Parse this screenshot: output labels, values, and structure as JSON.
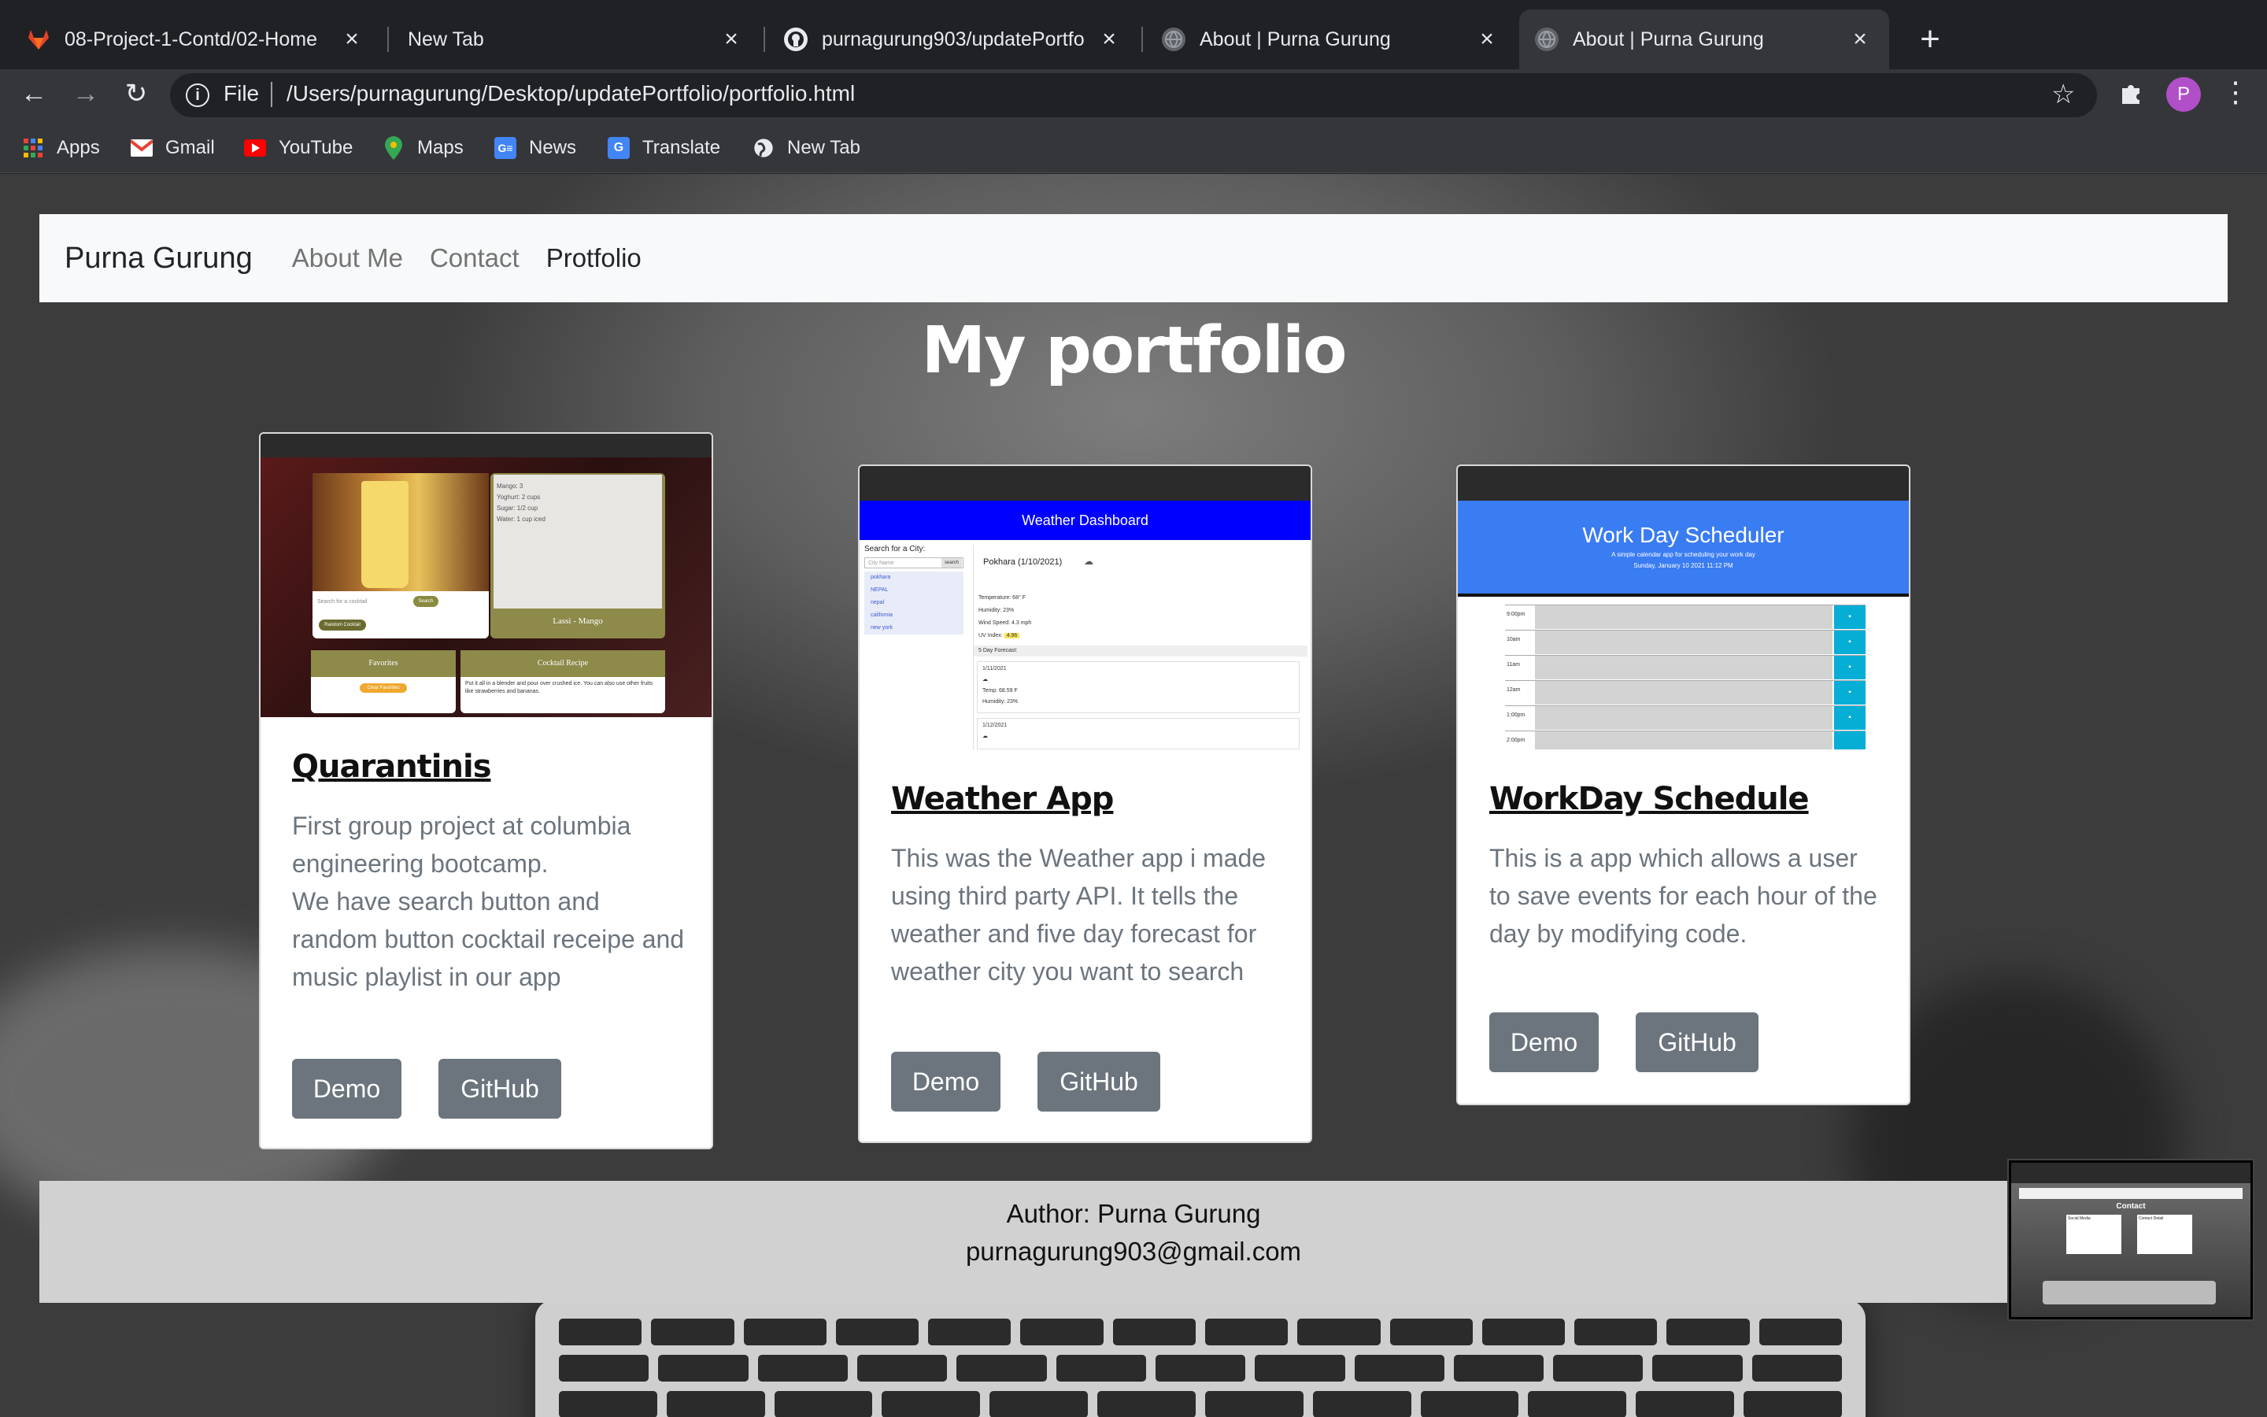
{
  "browser": {
    "tabs": [
      {
        "title": "08-Project-1-Contd/02-Home",
        "icon": "gitlab-icon",
        "active": false
      },
      {
        "title": "New Tab",
        "icon": "",
        "active": false
      },
      {
        "title": "purnagurung903/updatePortfo",
        "icon": "github-icon",
        "active": false
      },
      {
        "title": "About | Purna Gurung",
        "icon": "globe-icon",
        "active": false
      },
      {
        "title": "About | Purna Gurung",
        "icon": "globe-icon",
        "active": true
      }
    ],
    "new_tab_glyph": "+",
    "address": {
      "scheme_label": "File",
      "url": "/Users/purnagurung/Desktop/updatePortfolio/portfolio.html"
    },
    "profile_initial": "P",
    "bookmarks": [
      {
        "label": "Apps",
        "icon": "apps-grid-icon"
      },
      {
        "label": "Gmail",
        "icon": "gmail-icon"
      },
      {
        "label": "YouTube",
        "icon": "youtube-icon"
      },
      {
        "label": "Maps",
        "icon": "maps-icon"
      },
      {
        "label": "News",
        "icon": "news-icon"
      },
      {
        "label": "Translate",
        "icon": "translate-icon"
      },
      {
        "label": "New Tab",
        "icon": "globe-icon"
      }
    ]
  },
  "navbar": {
    "brand": "Purna Gurung",
    "links": [
      {
        "label": "About Me",
        "active": false
      },
      {
        "label": "Contact",
        "active": false
      },
      {
        "label": "Protfolio",
        "active": true
      }
    ]
  },
  "page_title": "My portfolio",
  "projects": [
    {
      "title": "Quarantinis",
      "description": "First group project at columbia engineering bootcamp.\nWe have search button and random button cocktail receipe and music playlist in our app",
      "demo_label": "Demo",
      "github_label": "GitHub",
      "thumbnail": {
        "panel_lines": [
          "Mango: 3",
          "Yoghurt: 2 cups",
          "Sugar: 1/2 cup",
          "Water: 1 cup iced"
        ],
        "drink_name": "Lassi - Mango",
        "favorites": "Favorites",
        "cocktail_recipe": "Cocktail Recipe",
        "recipe_text": "Put it all in a blender and pour over crushed ice. You can also use other fruits like strawberries and bananas.",
        "search_placeholder": "Search for a cocktail",
        "search_btn": "Search",
        "random_btn": "Random Cocktail",
        "clear_btn": "Clear Favorites"
      }
    },
    {
      "title": "Weather App",
      "description": "This was the Weather app i made using third party API. It tells the weather and five day forecast for weather city you want to search",
      "demo_label": "Demo",
      "github_label": "GitHub",
      "thumbnail": {
        "header": "Weather Dashboard",
        "search_label": "Search for a City:",
        "search_placeholder": "City Name",
        "search_btn": "search",
        "cities": [
          "pokhara",
          "NEPAL",
          "nepal",
          "california",
          "new york"
        ],
        "current_city": "Pokhara (1/10/2021)",
        "stats": [
          "Temperature: 68° F",
          "Humidity: 23%",
          "Wind Speed: 4.3 mph"
        ],
        "uv_label": "UV Index:",
        "uv_value": "4.96",
        "forecast_label": "5 Day Forecast:",
        "forecast_date_1": "1/11/2021",
        "forecast_temp_1": "Temp: 68.59 F",
        "forecast_humidity_1": "Humidity: 23%",
        "forecast_date_2": "1/12/2021"
      }
    },
    {
      "title": "WorkDay Schedule",
      "description": "This is a app which allows a user to save events for each hour of the day by modifying code.",
      "demo_label": "Demo",
      "github_label": "GitHub",
      "thumbnail": {
        "header": "Work Day Scheduler",
        "subheader": "A simple calendar app for scheduling your work day",
        "date": "Sunday, January 10 2021 11:12 PM",
        "hours": [
          "9:00pm",
          "10am",
          "11am",
          "12am",
          "1:00pm",
          "2:00pm"
        ]
      }
    }
  ],
  "footer": {
    "author": "Author: Purna Gurung",
    "email": "purnagurung903@gmail.com"
  },
  "pip": {
    "heading": "Contact",
    "col1": "Social Media",
    "col2": "Contact Detail"
  },
  "colors": {
    "browser_bg": "#202124",
    "toolbar_bg": "#35363a",
    "navbar_bg": "#f8f9fa",
    "button_gray": "#6c757d",
    "weather_header": "#0000ff",
    "scheduler_header": "#3a7cf2",
    "footer_bg": "#d1d1d1",
    "profile_purple": "#b04fc7"
  }
}
